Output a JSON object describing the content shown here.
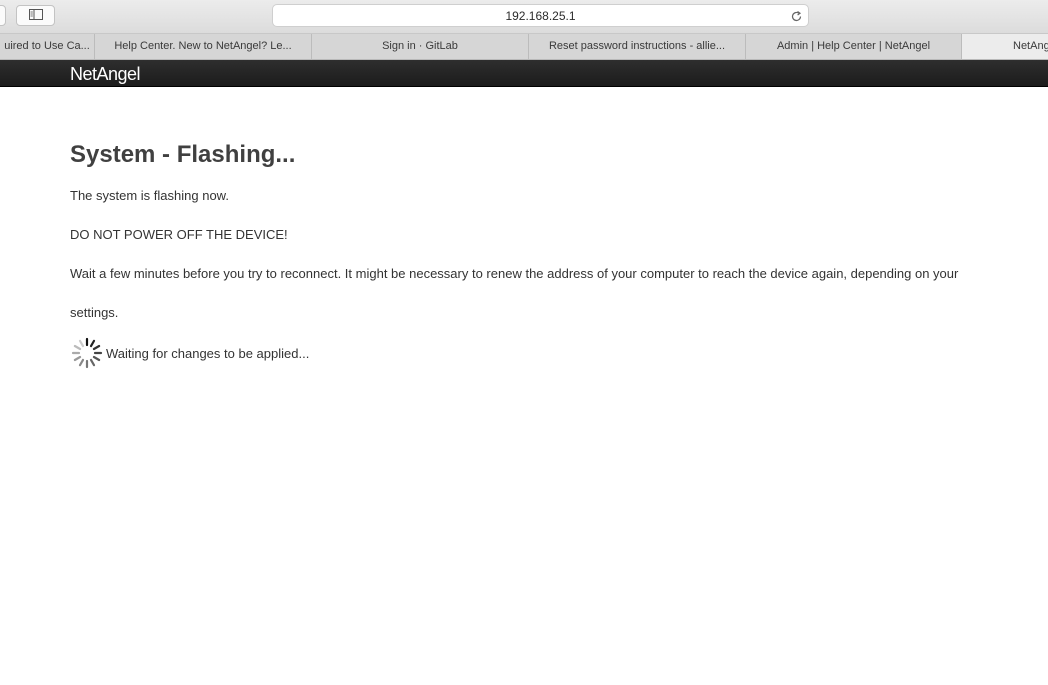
{
  "browser": {
    "url": "192.168.25.1",
    "tabs": [
      {
        "label": "uired to Use Ca...",
        "active": false
      },
      {
        "label": "Help Center. New to NetAngel? Le...",
        "active": false
      },
      {
        "label": "Sign in · GitLab",
        "active": false
      },
      {
        "label": "Reset password instructions - allie...",
        "active": false
      },
      {
        "label": "Admin | Help Center | NetAngel",
        "active": false
      },
      {
        "label": "NetAngel",
        "active": true
      }
    ]
  },
  "header": {
    "brand": "NetAngel"
  },
  "main": {
    "title": "System - Flashing...",
    "line1": "The system is flashing now.",
    "line2": "DO NOT POWER OFF THE DEVICE!",
    "line3": "Wait a few minutes before you try to reconnect. It might be necessary to renew the address of your computer to reach the device again, depending on your settings.",
    "waiting": "Waiting for changes to be applied..."
  },
  "icons": {
    "sidebar": "sidebar-toggle-icon",
    "reload": "reload-icon",
    "spinner": "loading-spinner-icon"
  },
  "colors": {
    "header_bg": "#232323",
    "brand_text": "#ffffff",
    "title_text": "#404040"
  }
}
